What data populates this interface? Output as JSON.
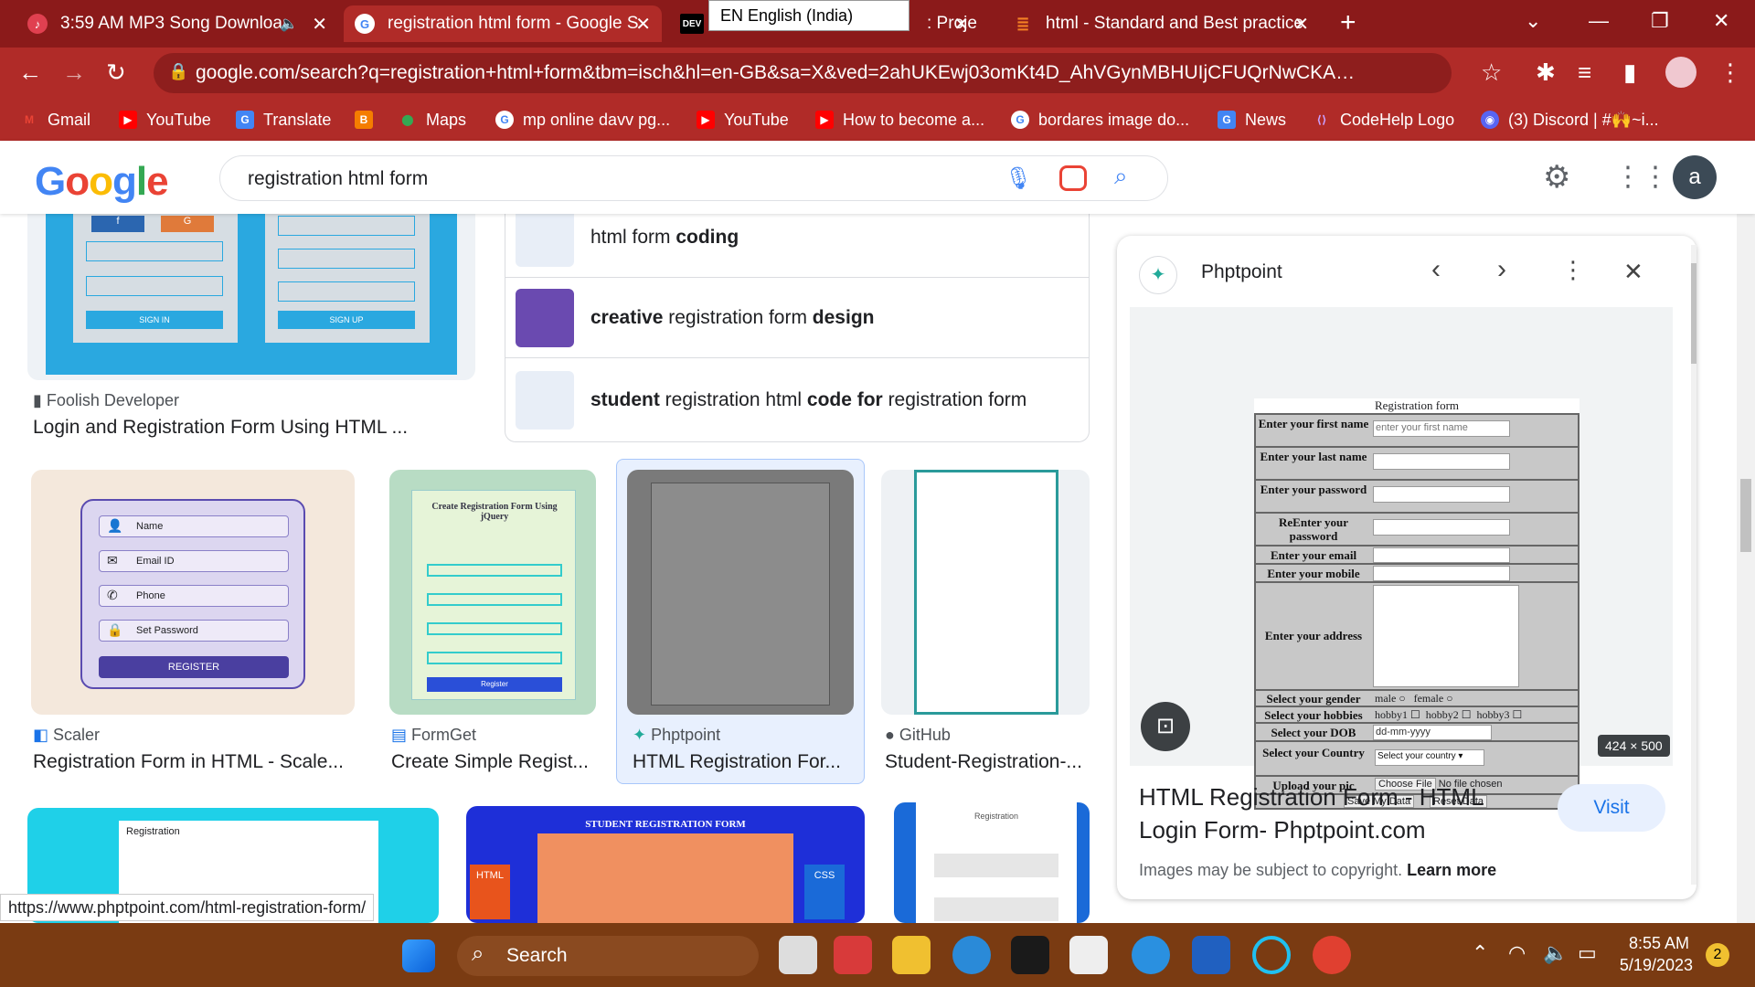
{
  "tabs": [
    {
      "title": "3:59 AM MP3 Song Downloa",
      "icon": "music-icon"
    },
    {
      "title": "registration html form - Google S",
      "icon": "google-icon"
    },
    {
      "title": ": Proje",
      "icon": "dev-icon"
    },
    {
      "title": "html - Standard and Best practice",
      "icon": "stackoverflow-icon"
    }
  ],
  "tooltip": "EN English (India)",
  "address": "google.com/search?q=registration+html+form&tbm=isch&hl=en-GB&sa=X&ved=2ahUKEwj03omKt4D_AhVGynMBHUIjCFUQrNwCKAB6BQgB...",
  "bookmarks": [
    "Gmail",
    "YouTube",
    "Translate",
    "Maps",
    "mp online davv pg...",
    "YouTube",
    "How to become a...",
    "bordares image do...",
    "News",
    "CodeHelp Logo",
    "(3) Discord | #🙌~i..."
  ],
  "google": {
    "logo": "Google",
    "query": "registration html form",
    "avatar_letter": "a"
  },
  "top_card": {
    "source": "Foolish Developer",
    "title": "Login and Registration Form Using HTML ...",
    "btn1": "SIGN IN",
    "btn2": "SIGN UP",
    "f": "f",
    "g": "G"
  },
  "suggestions": [
    {
      "parts": [
        [
          "html form ",
          false
        ],
        [
          "coding",
          true
        ]
      ]
    },
    {
      "parts": [
        [
          "creative",
          true
        ],
        [
          " registration form ",
          false
        ],
        [
          "design",
          true
        ]
      ]
    },
    {
      "parts": [
        [
          "student",
          true
        ],
        [
          " registration html ",
          false
        ],
        [
          "code for",
          true
        ],
        [
          " registration form",
          false
        ]
      ]
    }
  ],
  "results": [
    {
      "source": "Scaler",
      "title": "Registration Form in HTML - Scale..."
    },
    {
      "source": "FormGet",
      "title": "Create Simple Regist..."
    },
    {
      "source": "Phptpoint",
      "title": "HTML Registration For..."
    },
    {
      "source": "GitHub",
      "title": "Student-Registration-..."
    }
  ],
  "scaler_fields": [
    "Name",
    "Email ID",
    "Phone",
    "Set Password"
  ],
  "scaler_button": "REGISTER",
  "formget": {
    "title": "Create Registration Form Using jQuery",
    "button": "Register"
  },
  "bottom_cards": {
    "card1": "Registration",
    "card2": "STUDENT REGISTRATION FORM",
    "card3": "Registration",
    "html": "HTML",
    "css": "CSS"
  },
  "panel": {
    "source": "Phptpoint",
    "title": "HTML Registration Form - HTML Login Form- Phptpoint.com",
    "visit": "Visit",
    "copyright": "Images may be subject to copyright.",
    "learn_more": "Learn more",
    "size": "424 × 500",
    "form": {
      "caption": "Registration form",
      "first_name": "Enter your first name",
      "first_placeholder": "enter your first name",
      "last_name": "Enter your last name",
      "password": "Enter your password",
      "repassword": "ReEnter your password",
      "email": "Enter your email",
      "mobile": "Enter your mobile",
      "address": "Enter your address",
      "gender": "Select your gender",
      "male": "male",
      "female": "female",
      "hobbies": "Select your hobbies",
      "hobby1": "hobby1",
      "hobby2": "hobby2",
      "hobby3": "hobby3",
      "dob": "Select your DOB",
      "dob_value": "dd-mm-yyyy",
      "country": "Select your Country",
      "country_value": "Select your country ▾",
      "pic": "Upload your pic",
      "choose": "Choose File",
      "no_file": "No file chosen",
      "save": "Save My Data",
      "reset": "Reset Data"
    }
  },
  "status_url": "https://www.phptpoint.com/html-registration-form/",
  "taskbar": {
    "search": "Search",
    "time": "8:55 AM",
    "date": "5/19/2023",
    "badge": "2"
  }
}
